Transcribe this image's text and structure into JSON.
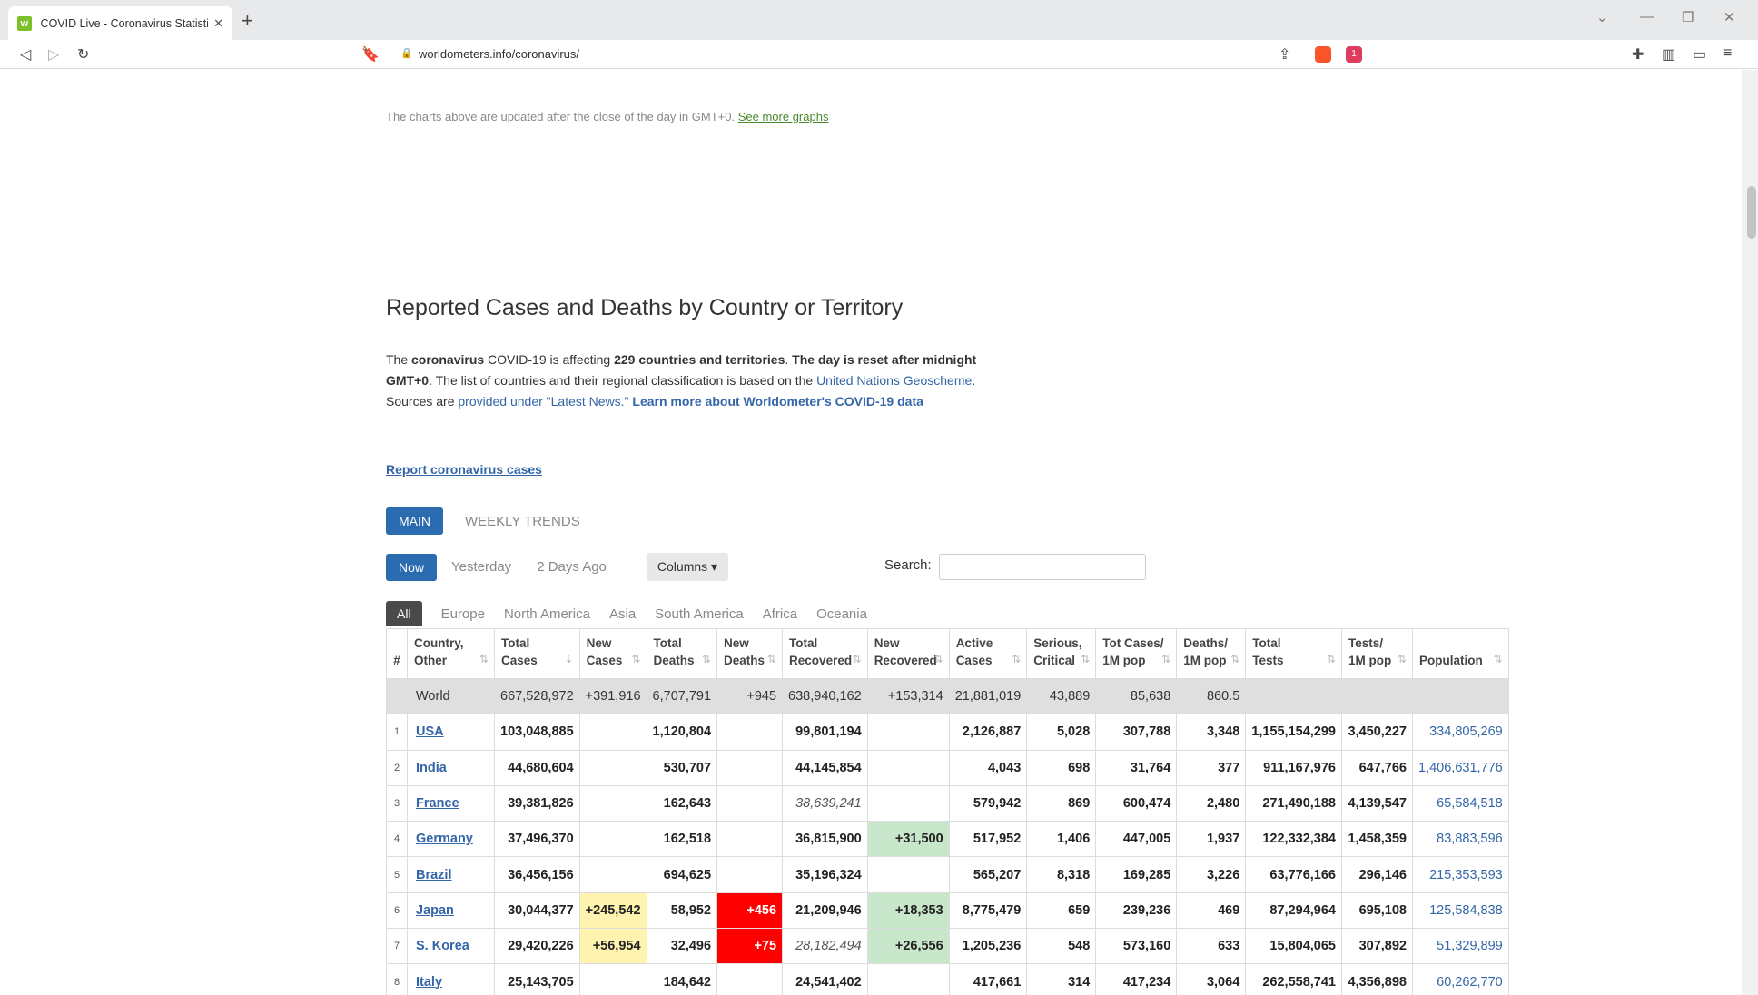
{
  "browser": {
    "tab_title": "COVID Live - Coronavirus Statistics",
    "url": "worldometers.info/coronavirus/",
    "favicon_letter": "w",
    "brave_badge": "1"
  },
  "page": {
    "chart_note": "The charts above are updated after the close of the day in GMT+0.",
    "chart_note_link": "See more graphs",
    "section_title": "Reported Cases and Deaths by Country or Territory",
    "intro": {
      "t1": "The ",
      "b1": "coronavirus",
      "t2": " COVID-19 is affecting ",
      "b2": "229 countries and territories",
      "t3": ". ",
      "b3": "The day is reset after midnight GMT+0",
      "t4": ". The list of countries and their regional classification is based on the ",
      "link1": "United Nations Geoscheme",
      "t5": ". Sources are ",
      "link2": "provided under \"Latest News.\"",
      "t6": " ",
      "boldlink": "Learn more about Worldometer's COVID-19 data"
    },
    "report_link": "Report coronavirus cases",
    "view_tabs": {
      "main": "MAIN",
      "weekly": "WEEKLY TRENDS"
    },
    "day_tabs": {
      "now": "Now",
      "yesterday": "Yesterday",
      "two_days": "2 Days Ago",
      "columns": "Columns ▾"
    },
    "search_label": "Search:",
    "regions": [
      "All",
      "Europe",
      "North America",
      "Asia",
      "South America",
      "Africa",
      "Oceania"
    ]
  },
  "table": {
    "headers": [
      {
        "l1": "#",
        "l2": ""
      },
      {
        "l1": "Country,",
        "l2": "Other"
      },
      {
        "l1": "Total",
        "l2": "Cases"
      },
      {
        "l1": "New",
        "l2": "Cases"
      },
      {
        "l1": "Total",
        "l2": "Deaths"
      },
      {
        "l1": "New",
        "l2": "Deaths"
      },
      {
        "l1": "Total",
        "l2": "Recovered"
      },
      {
        "l1": "New",
        "l2": "Recovered"
      },
      {
        "l1": "Active",
        "l2": "Cases"
      },
      {
        "l1": "Serious,",
        "l2": "Critical"
      },
      {
        "l1": "Tot Cases/",
        "l2": "1M pop"
      },
      {
        "l1": "Deaths/",
        "l2": "1M pop"
      },
      {
        "l1": "Total",
        "l2": "Tests"
      },
      {
        "l1": "Tests/",
        "l2": "1M pop"
      },
      {
        "l1": "",
        "l2": "Population"
      }
    ],
    "world": [
      "",
      "World",
      "667,528,972",
      "+391,916",
      "6,707,791",
      "+945",
      "638,940,162",
      "+153,314",
      "21,881,019",
      "43,889",
      "85,638",
      "860.5",
      "",
      "",
      ""
    ],
    "rows": [
      [
        "1",
        "USA",
        "103,048,885",
        "",
        "1,120,804",
        "",
        "99,801,194",
        "",
        "2,126,887",
        "5,028",
        "307,788",
        "3,348",
        "1,155,154,299",
        "3,450,227",
        "334,805,269"
      ],
      [
        "2",
        "India",
        "44,680,604",
        "",
        "530,707",
        "",
        "44,145,854",
        "",
        "4,043",
        "698",
        "31,764",
        "377",
        "911,167,976",
        "647,766",
        "1,406,631,776"
      ],
      [
        "3",
        "France",
        "39,381,826",
        "",
        "162,643",
        "",
        "38,639,241",
        "",
        "579,942",
        "869",
        "600,474",
        "2,480",
        "271,490,188",
        "4,139,547",
        "65,584,518"
      ],
      [
        "4",
        "Germany",
        "37,496,370",
        "",
        "162,518",
        "",
        "36,815,900",
        "+31,500",
        "517,952",
        "1,406",
        "447,005",
        "1,937",
        "122,332,384",
        "1,458,359",
        "83,883,596"
      ],
      [
        "5",
        "Brazil",
        "36,456,156",
        "",
        "694,625",
        "",
        "35,196,324",
        "",
        "565,207",
        "8,318",
        "169,285",
        "3,226",
        "63,776,166",
        "296,146",
        "215,353,593"
      ],
      [
        "6",
        "Japan",
        "30,044,377",
        "+245,542",
        "58,952",
        "+456",
        "21,209,946",
        "+18,353",
        "8,775,479",
        "659",
        "239,236",
        "469",
        "87,294,964",
        "695,108",
        "125,584,838"
      ],
      [
        "7",
        "S. Korea",
        "29,420,226",
        "+56,954",
        "32,496",
        "+75",
        "28,182,494",
        "+26,556",
        "1,205,236",
        "548",
        "573,160",
        "633",
        "15,804,065",
        "307,892",
        "51,329,899"
      ],
      [
        "8",
        "Italy",
        "25,143,705",
        "",
        "184,642",
        "",
        "24,541,402",
        "",
        "417,661",
        "314",
        "417,234",
        "3,064",
        "262,558,741",
        "4,356,898",
        "60,262,770"
      ]
    ]
  }
}
